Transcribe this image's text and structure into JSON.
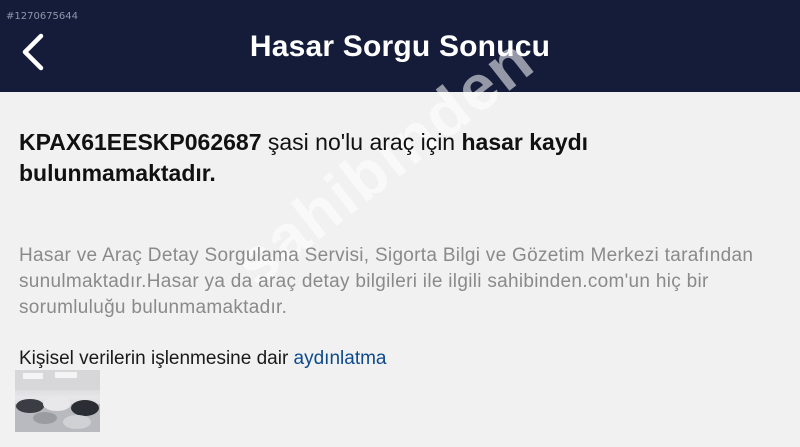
{
  "header": {
    "ad_id": "#1270675644",
    "title": "Hasar Sorgu Sonucu",
    "back_icon": "chevron-left-icon",
    "background": "#141c3a"
  },
  "result": {
    "chassis_no": "KPAX61EESKP062687",
    "text_middle": " şasi no'lu araç için ",
    "text_bold_end": "hasar kaydı bulunmamaktadır."
  },
  "info": {
    "text": "Hasar ve Araç Detay Sorgulama Servisi, Sigorta Bilgi ve Gözetim Merkezi tarafından sunulmaktadır.Hasar ya da araç detay bilgileri ile ilgili sahibinden.com'un hiç bir sorumluluğu bulunmamaktadır."
  },
  "consent": {
    "text": "Kişisel verilerin işlenmesine dair ",
    "link_label": "aydınlatma",
    "link_color": "#0d4a8c"
  },
  "watermark": {
    "text": "sahibinden"
  },
  "thumbnail": {
    "subject": "car showroom photo"
  }
}
